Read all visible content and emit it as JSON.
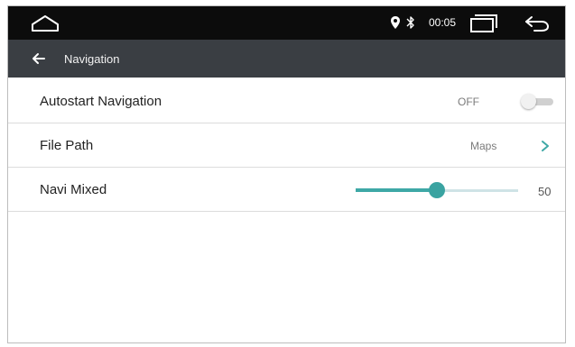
{
  "status_bar": {
    "time": "00:05",
    "icons": [
      "home-icon",
      "location-pin-icon",
      "bluetooth-icon",
      "recent-apps-icon",
      "back-icon"
    ]
  },
  "header": {
    "title": "Navigation",
    "back_icon": "arrow-left-icon"
  },
  "settings": {
    "autostart": {
      "label": "Autostart Navigation",
      "value": "OFF",
      "enabled": false
    },
    "file_path": {
      "label": "File Path",
      "value": "Maps",
      "icon": "chevron-right-icon"
    },
    "navi_mixed": {
      "label": "Navi Mixed",
      "value": "50",
      "level": 0.5
    }
  },
  "colors": {
    "status_bar_bg": "#0c0c0c",
    "title_bar_bg": "#3a3e43",
    "accent": "#3ea8a6",
    "divider": "#dcdcdc"
  }
}
